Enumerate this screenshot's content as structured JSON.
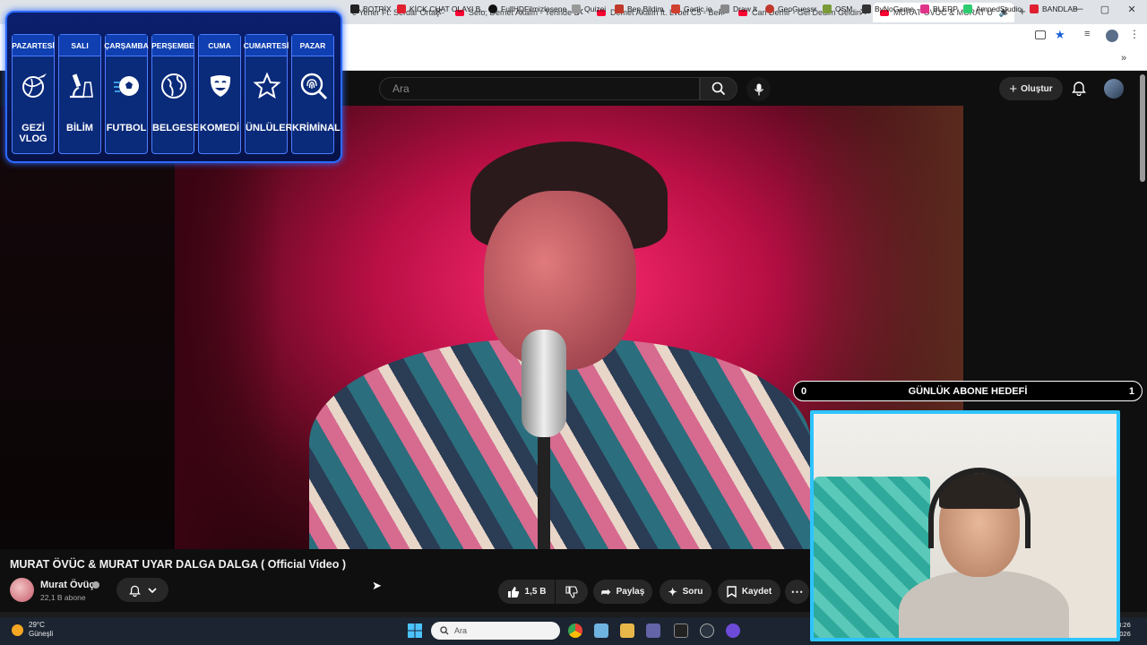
{
  "browser": {
    "tabs": [
      {
        "title": "e Yener Ft. Serdar Ortaç -",
        "active": false
      },
      {
        "title": "Sefo, Demet Akalın - Yerinde D",
        "active": false
      },
      {
        "title": "Demet Akalın ft. Lvbel C5 - Ben",
        "active": false
      },
      {
        "title": "Can Demir - Gel Dedim Geldin",
        "active": false
      },
      {
        "title": "MURAT ÖVÜC & MURAT U",
        "active": true
      }
    ],
    "new_tab": "+",
    "window_controls": [
      "—",
      "▢",
      "✕"
    ]
  },
  "bookmarks": [
    {
      "label": "BOTRİX",
      "color": "#222222"
    },
    {
      "label": "KİCK CHAT OLAYI B...",
      "color": "#e02030"
    },
    {
      "label": "FullHDFilmizlesene",
      "color": "#111111"
    },
    {
      "label": "Quizei",
      "color": "#999999"
    },
    {
      "label": "Ben Bildim",
      "color": "#c0392b"
    },
    {
      "label": "Gartic.io",
      "color": "#d0402f"
    },
    {
      "label": "Draw It",
      "color": "#888888"
    },
    {
      "label": "GeoGuessr",
      "color": "#c0392b"
    },
    {
      "label": "OSM",
      "color": "#7a9a3a"
    },
    {
      "label": "ByNoGame",
      "color": "#333333"
    },
    {
      "label": "BLERP",
      "color": "#e0338a"
    },
    {
      "label": "AmpedStudio",
      "color": "#2ecc71"
    },
    {
      "label": "BANDLAB",
      "color": "#e02030"
    }
  ],
  "youtube": {
    "search_placeholder": "Ara",
    "create_label": "Oluştur",
    "video_title": "MURAT ÖVÜC & MURAT UYAR DALGA DALGA ( Official Video )",
    "channel_name": "Murat Övüç",
    "subscribers": "22,1 B abone",
    "likes": "1,5 B",
    "share_label": "Paylaş",
    "ask_label": "Soru",
    "save_label": "Kaydet"
  },
  "schedule": [
    {
      "day": "PAZARTESİ",
      "label": "GEZİ VLOG",
      "icon": "globe-plane-icon"
    },
    {
      "day": "SALI",
      "label": "BİLİM",
      "icon": "microscope-icon"
    },
    {
      "day": "ÇARŞAMBA",
      "label": "FUTBOL",
      "icon": "football-icon"
    },
    {
      "day": "PERŞEMBE",
      "label": "BELGESEL",
      "icon": "globe-icon"
    },
    {
      "day": "CUMA",
      "label": "KOMEDİ",
      "icon": "theater-mask-icon"
    },
    {
      "day": "CUMARTESİ",
      "label": "ÜNLÜLER",
      "icon": "star-icon"
    },
    {
      "day": "PAZAR",
      "label": "KRİMİNAL",
      "icon": "fingerprint-search-icon"
    }
  ],
  "goal": {
    "label": "GÜNLÜK ABONE HEDEFİ",
    "start": "0",
    "end": "1"
  },
  "taskbar": {
    "temperature": "29°C",
    "weather": "Güneşli",
    "search_placeholder": "Ara",
    "time": "13:26",
    "date": "2026"
  },
  "colors": {
    "accent": "#2d69ff",
    "youtube_red": "#ff0033",
    "cam_border": "#2ec4ff"
  }
}
